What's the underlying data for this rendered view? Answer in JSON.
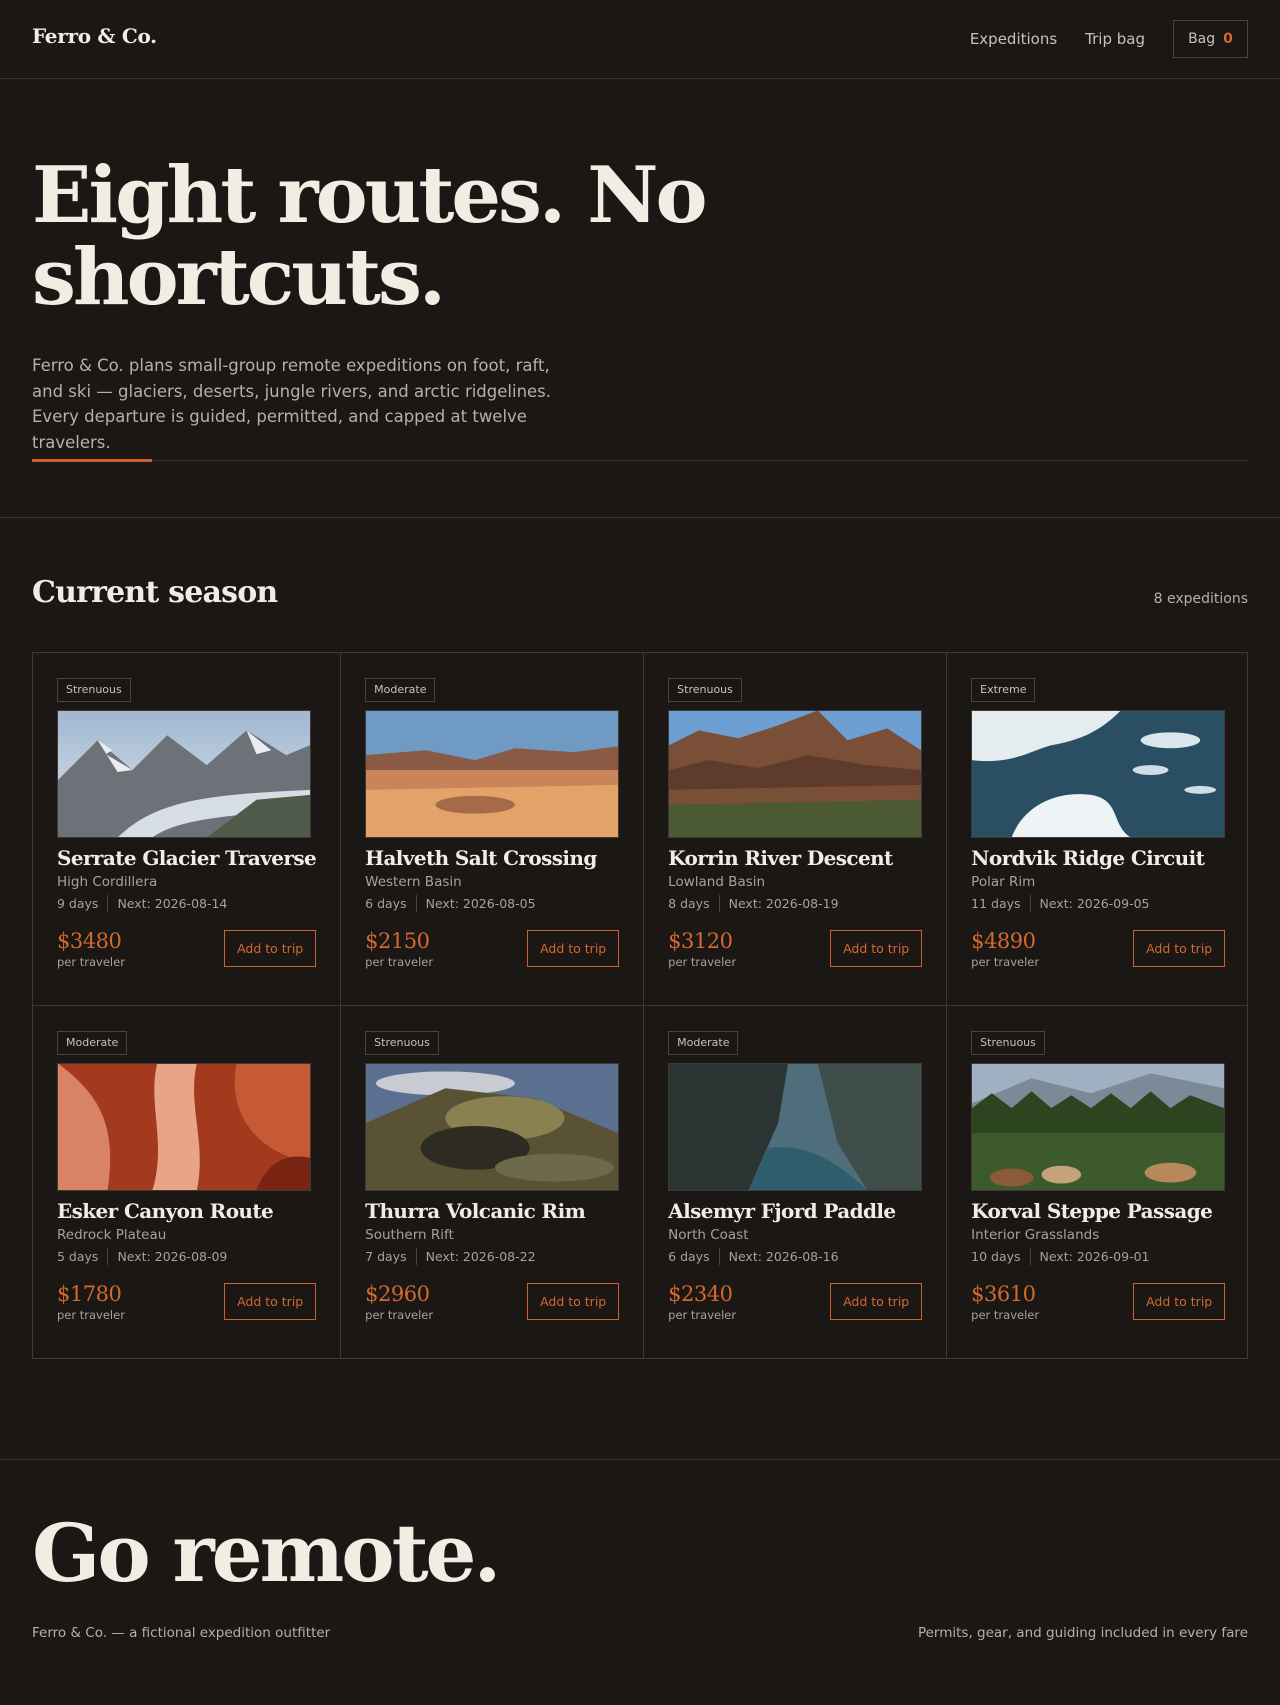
{
  "header": {
    "brand": "Ferro & Co.",
    "nav": [
      {
        "label": "Expeditions"
      },
      {
        "label": "Trip bag"
      }
    ],
    "bag": {
      "label": "Bag",
      "count": "0"
    }
  },
  "hero": {
    "title": "Eight routes. No shortcuts.",
    "description": "Ferro & Co. plans small-group remote expeditions on foot, raft, and ski — glaciers, deserts, jungle rivers, and arctic ridgelines. Every departure is guided, permitted, and capped at twelve travelers."
  },
  "season": {
    "title": "Current season",
    "count": "8 expeditions"
  },
  "expeditions": [
    {
      "difficulty": "Strenuous",
      "name": "Serrate Glacier Traverse",
      "region": "High Cordillera",
      "days": "9 days",
      "next": "Next: 2026-08-14",
      "price": "$3480",
      "per": "per traveler",
      "cta": "Add to trip",
      "scene": "glacier"
    },
    {
      "difficulty": "Moderate",
      "name": "Halveth Salt Crossing",
      "region": "Western Basin",
      "days": "6 days",
      "next": "Next: 2026-08-05",
      "price": "$2150",
      "per": "per traveler",
      "cta": "Add to trip",
      "scene": "desert"
    },
    {
      "difficulty": "Strenuous",
      "name": "Korrin River Descent",
      "region": "Lowland Basin",
      "days": "8 days",
      "next": "Next: 2026-08-19",
      "price": "$3120",
      "per": "per traveler",
      "cta": "Add to trip",
      "scene": "canyon"
    },
    {
      "difficulty": "Extreme",
      "name": "Nordvik Ridge Circuit",
      "region": "Polar Rim",
      "days": "11 days",
      "next": "Next: 2026-09-05",
      "price": "$4890",
      "per": "per traveler",
      "cta": "Add to trip",
      "scene": "ice"
    },
    {
      "difficulty": "Moderate",
      "name": "Esker Canyon Route",
      "region": "Redrock Plateau",
      "days": "5 days",
      "next": "Next: 2026-08-09",
      "price": "$1780",
      "per": "per traveler",
      "cta": "Add to trip",
      "scene": "slot"
    },
    {
      "difficulty": "Strenuous",
      "name": "Thurra Volcanic Rim",
      "region": "Southern Rift",
      "days": "7 days",
      "next": "Next: 2026-08-22",
      "price": "$2960",
      "per": "per traveler",
      "cta": "Add to trip",
      "scene": "volcano"
    },
    {
      "difficulty": "Moderate",
      "name": "Alsemyr Fjord Paddle",
      "region": "North Coast",
      "days": "6 days",
      "next": "Next: 2026-08-16",
      "price": "$2340",
      "per": "per traveler",
      "cta": "Add to trip",
      "scene": "fjord"
    },
    {
      "difficulty": "Strenuous",
      "name": "Korval Steppe Passage",
      "region": "Interior Grasslands",
      "days": "10 days",
      "next": "Next: 2026-09-01",
      "price": "$3610",
      "per": "per traveler",
      "cta": "Add to trip",
      "scene": "steppe"
    }
  ],
  "footer": {
    "title": "Go remote.",
    "left": "Ferro & Co. — a fictional expedition outfitter",
    "right": "Permits, gear, and guiding included in every fare"
  },
  "colors": {
    "background": "#1b1714",
    "accent": "#d2692f",
    "text": "#f2ece3",
    "muted": "#a9a197",
    "border": "#3f3833"
  }
}
